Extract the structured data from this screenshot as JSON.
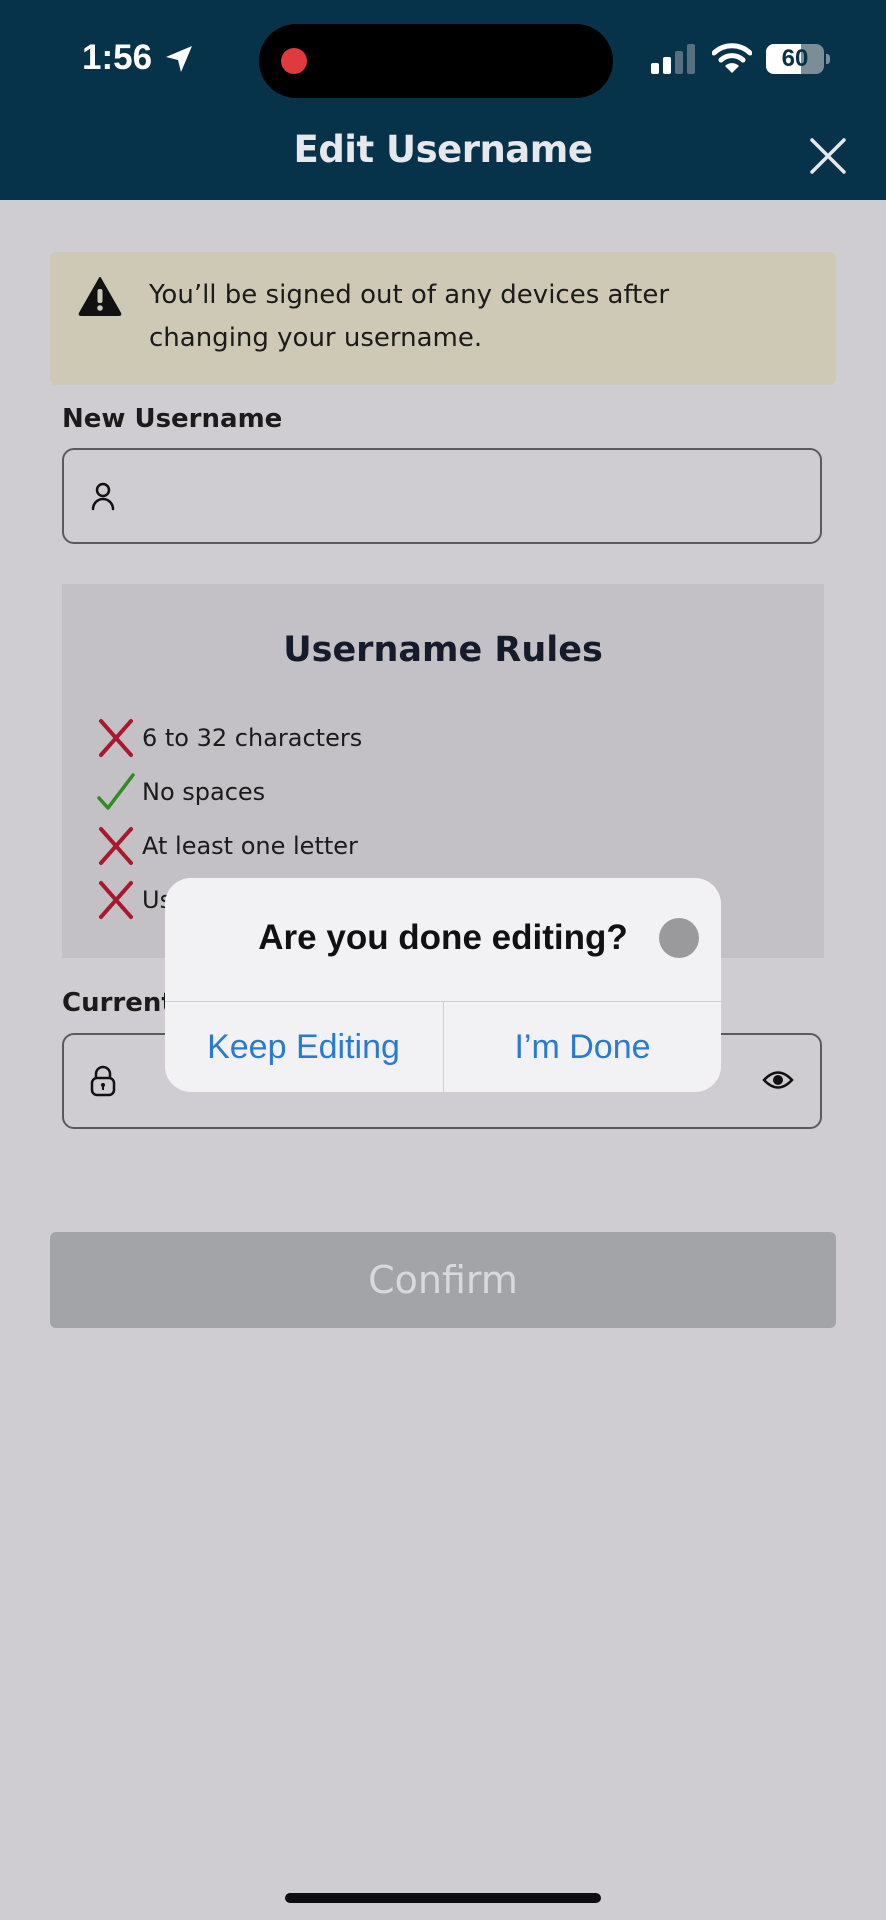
{
  "status_bar": {
    "time": "1:56",
    "battery_percent": "60",
    "battery_level": 0.6,
    "signal_bars_active": 2,
    "signal_bars_total": 4,
    "recording_indicator": true
  },
  "header": {
    "title": "Edit Username",
    "close_icon": "close-icon"
  },
  "warning": {
    "icon": "warning-icon",
    "text": "You’ll be signed out of any devices after changing your username."
  },
  "new_username": {
    "label": "New Username",
    "value": "",
    "placeholder": "",
    "icon": "user-icon"
  },
  "rules": {
    "title": "Username Rules",
    "items": [
      {
        "label": "6 to 32 characters",
        "status": "fail"
      },
      {
        "label": "No spaces",
        "status": "pass"
      },
      {
        "label": "At least one letter",
        "status": "fail"
      },
      {
        "label": "Us",
        "status": "fail"
      }
    ],
    "colors": {
      "fail": "#a8182f",
      "pass": "#2e8b22"
    }
  },
  "current_password": {
    "label": "Current",
    "value": "",
    "icon": "lock-icon",
    "toggle_icon": "eye-icon"
  },
  "confirm_button": {
    "label": "Confirm",
    "disabled": true
  },
  "alert": {
    "title": "Are you done editing?",
    "keep_editing": "Keep Editing",
    "done": "I’m Done"
  },
  "colors": {
    "header_bg": "#07334a",
    "page_bg": "#cfcdd1",
    "warning_bg": "#cec9b4",
    "alert_button": "#2a7ad0",
    "confirm_disabled_bg": "#a2a4a8"
  }
}
